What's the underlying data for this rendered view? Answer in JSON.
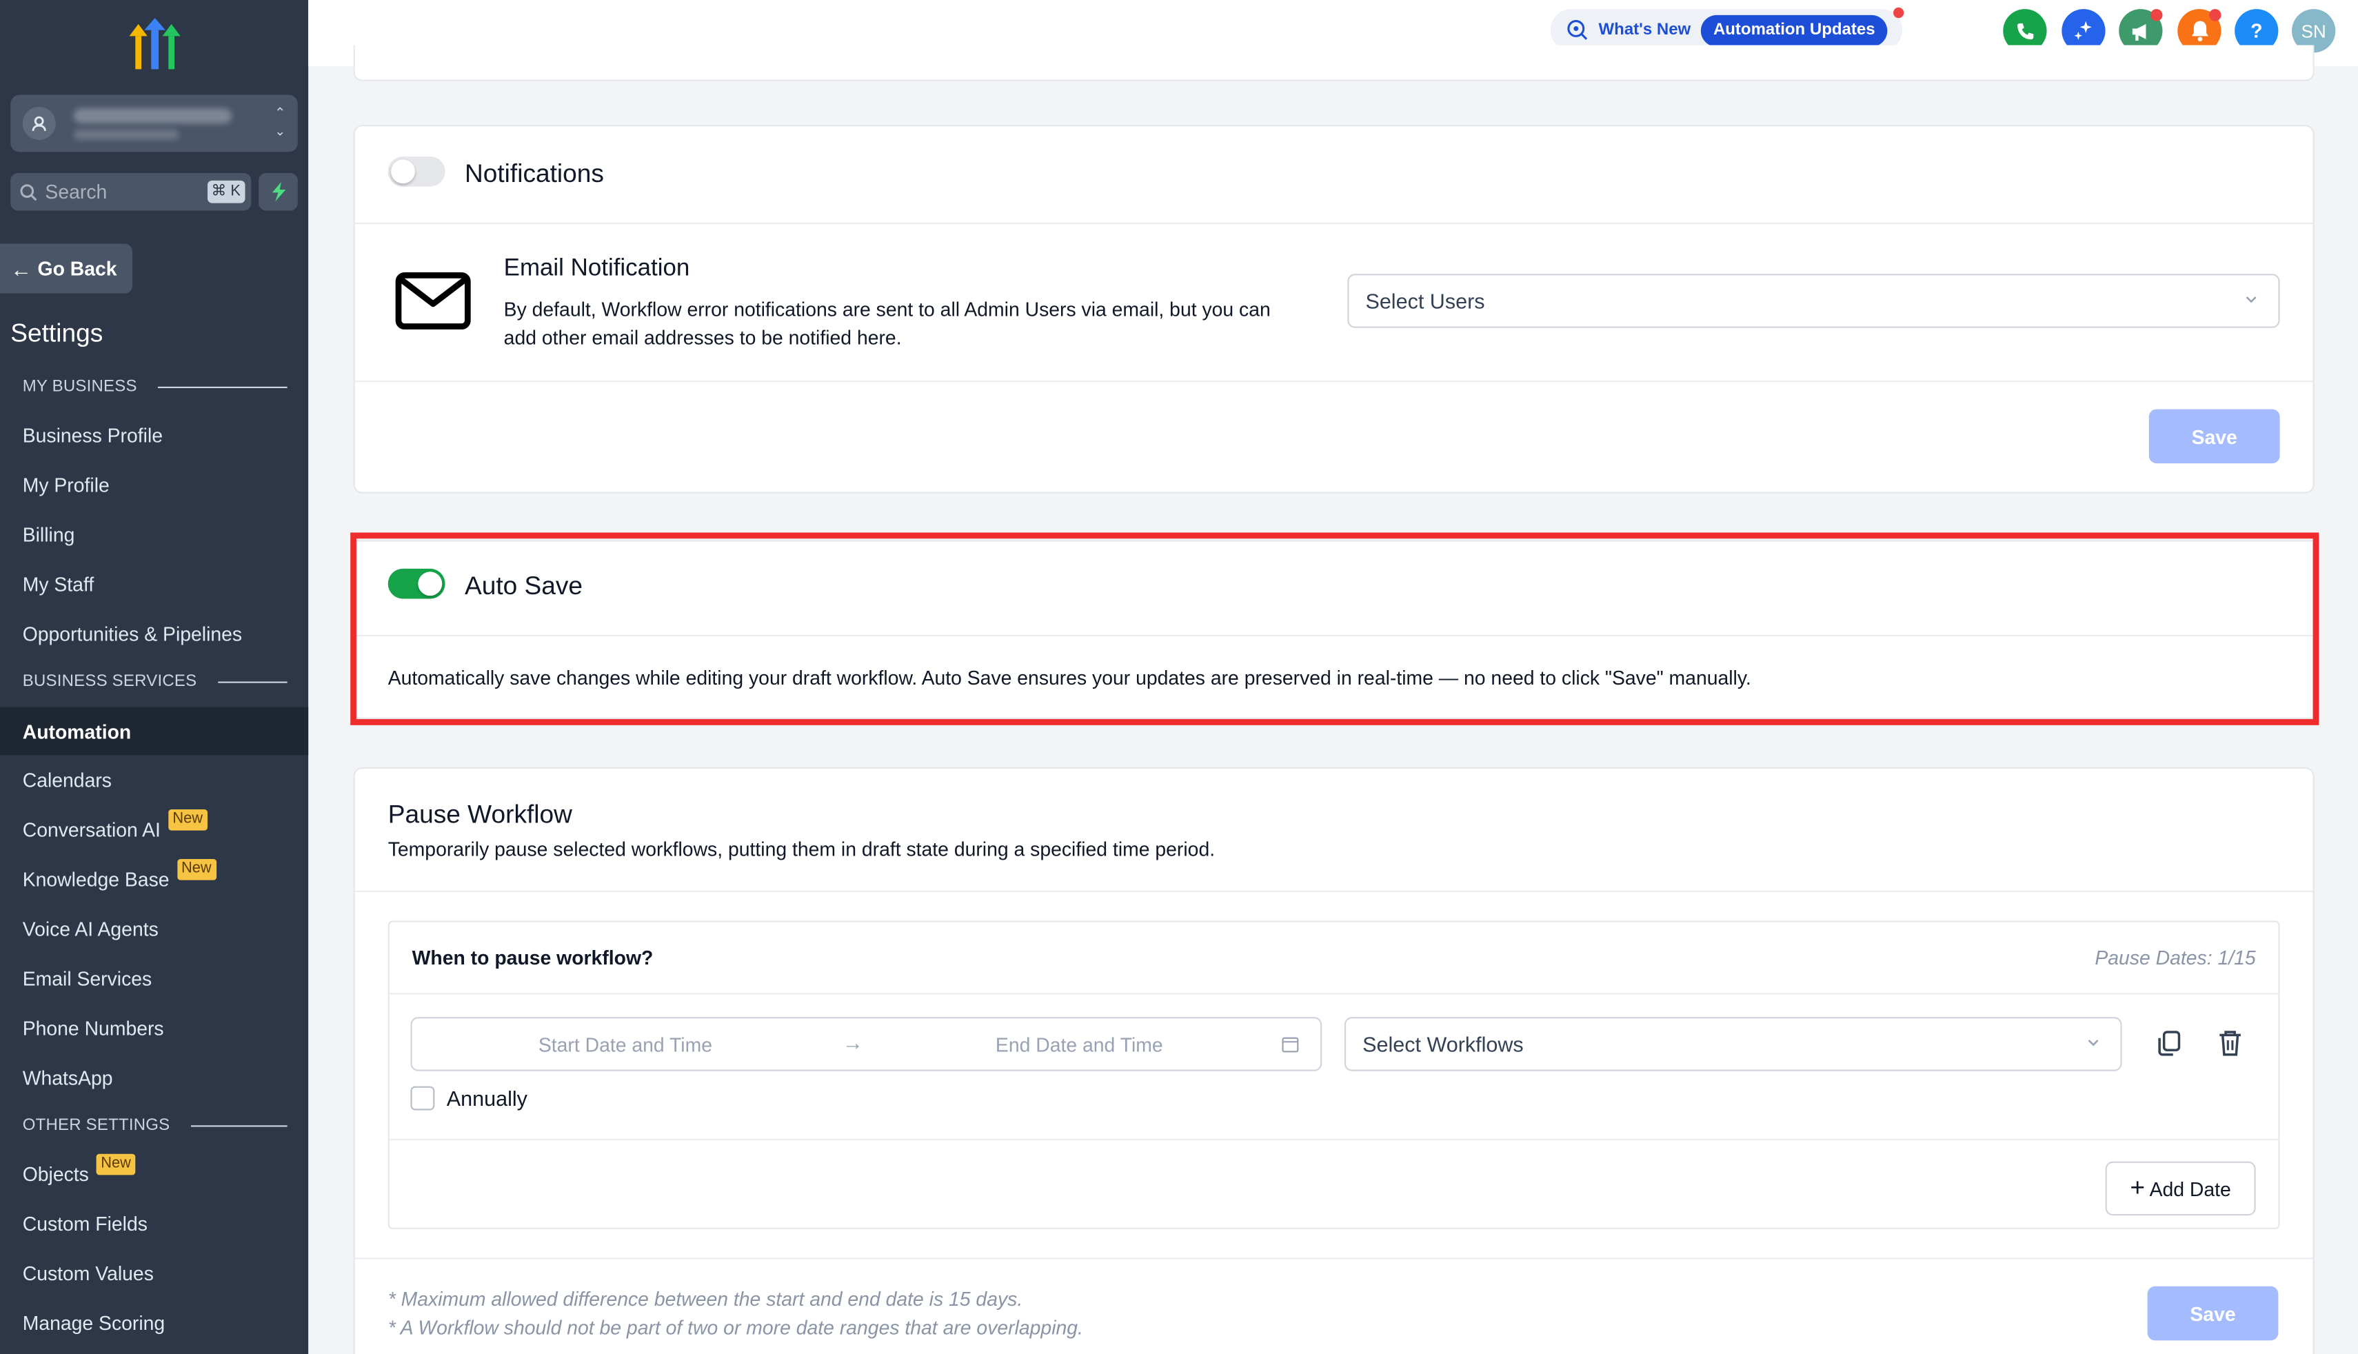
{
  "sidebar": {
    "search_placeholder": "Search",
    "search_shortcut": "⌘ K",
    "go_back": "Go Back",
    "settings_title": "Settings",
    "sections": {
      "my_business": "MY BUSINESS",
      "business_services": "BUSINESS SERVICES",
      "other_settings": "OTHER SETTINGS"
    },
    "items": [
      {
        "label": "Business Profile"
      },
      {
        "label": "My Profile"
      },
      {
        "label": "Billing"
      },
      {
        "label": "My Staff"
      },
      {
        "label": "Opportunities & Pipelines"
      },
      {
        "label": "Automation",
        "active": true
      },
      {
        "label": "Calendars"
      },
      {
        "label": "Conversation AI",
        "badge": "New"
      },
      {
        "label": "Knowledge Base",
        "badge": "New"
      },
      {
        "label": "Voice AI Agents"
      },
      {
        "label": "Email Services"
      },
      {
        "label": "Phone Numbers"
      },
      {
        "label": "WhatsApp"
      },
      {
        "label": "Objects",
        "badge": "New"
      },
      {
        "label": "Custom Fields"
      },
      {
        "label": "Custom Values"
      },
      {
        "label": "Manage Scoring"
      }
    ]
  },
  "topbar": {
    "whats_new": "What's New",
    "automation_updates": "Automation Updates",
    "avatar_initials": "SN",
    "help": "?",
    "icon_colors": {
      "phone": "#16a34a",
      "ai": "#2563eb",
      "megaphone": "#3f9a6b",
      "bell": "#f97316",
      "help": "#1d8cf8",
      "avatar": "#86b8c9"
    }
  },
  "notifications": {
    "title": "Notifications",
    "enabled": false,
    "email_title": "Email Notification",
    "email_desc_line1": "By default, Workflow error notifications are sent to all Admin Users via email, but you can",
    "email_desc_line2": "add other email addresses to be notified here.",
    "select_users_placeholder": "Select Users",
    "save_label": "Save"
  },
  "auto_save": {
    "title": "Auto Save",
    "enabled": true,
    "description": "Automatically save changes while editing your draft workflow. Auto Save ensures your updates are preserved in real-time — no need to click \"Save\" manually."
  },
  "pause_workflow": {
    "title": "Pause Workflow",
    "description": "Temporarily pause selected workflows, putting them in draft state during a specified time period.",
    "when_label": "When to pause workflow?",
    "pause_dates": "Pause Dates: 1/15",
    "start_placeholder": "Start Date and Time",
    "end_placeholder": "End Date and Time",
    "select_workflows_placeholder": "Select Workflows",
    "annually_label": "Annually",
    "add_date_label": "Add Date",
    "note1": "* Maximum allowed difference between the start and end date is 15 days.",
    "note2": "* A Workflow should not be part of two or more date ranges that are overlapping.",
    "save_label": "Save"
  },
  "colors": {
    "sidebar_bg": "#2d3748",
    "accent": "#1d4ed8",
    "toggle_on": "#16a34a",
    "save_disabled": "#a4bcfd",
    "highlight": "#ef2b2b",
    "badge_new": "#f6c343"
  }
}
